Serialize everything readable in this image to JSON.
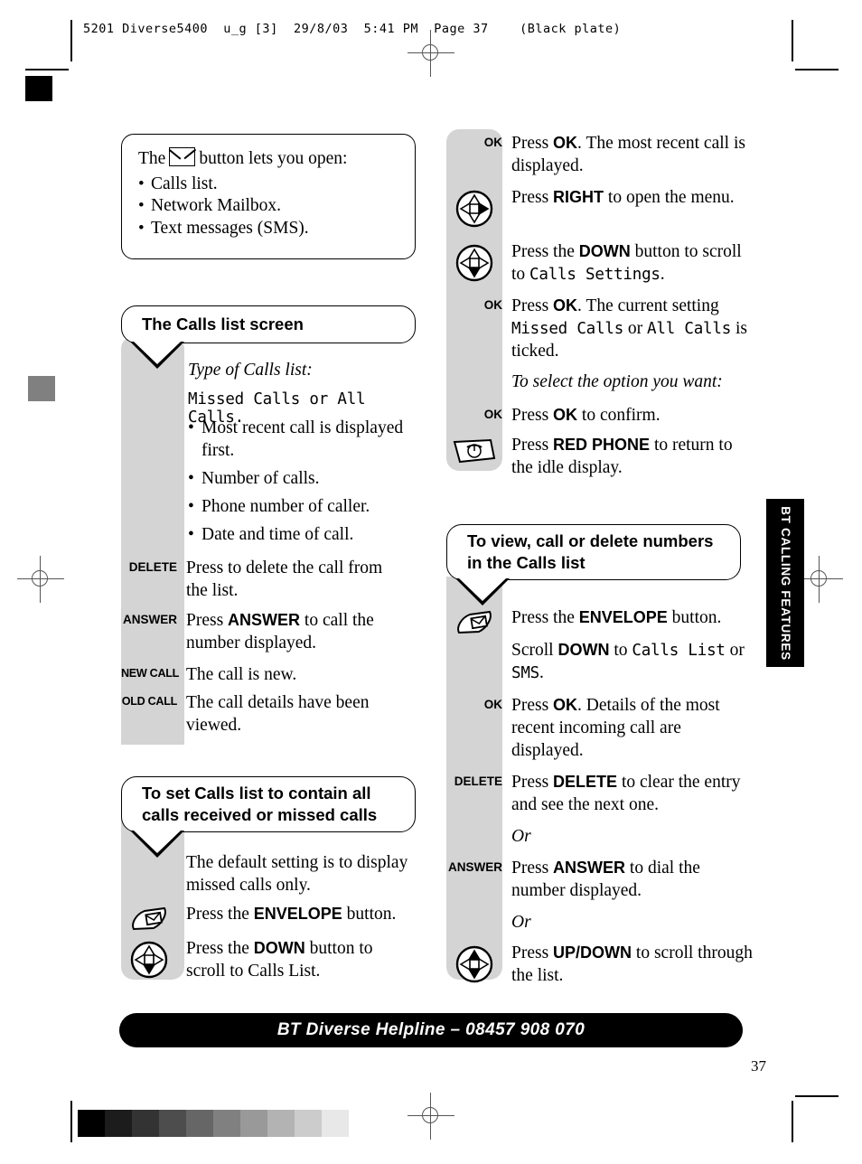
{
  "print_marks": {
    "slug": "5201 Diverse5400  u_g [3]  29/8/03  5:41 PM  Page 37    (Black plate)",
    "page_number": "37",
    "grayscale_swatches": [
      "#000000",
      "#1c1c1c",
      "#333333",
      "#4d4d4d",
      "#666666",
      "#808080",
      "#999999",
      "#b3b3b3",
      "#cccccc",
      "#e8e8e8"
    ],
    "corner_square_color": "#000000",
    "mid_square_color": "#808080"
  },
  "side_tab": {
    "label": "BT CALLING FEATURES"
  },
  "note_box": {
    "intro_before": "The",
    "icon": "envelope-icon",
    "intro_after": "button lets you open:",
    "items": [
      "Calls list.",
      "Network Mailbox.",
      "Text messages (SMS)."
    ]
  },
  "sections": [
    {
      "id": "calls-list-screen",
      "heading": "The Calls list screen",
      "rows": [
        {
          "key": "",
          "icon": "",
          "lines": [
            {
              "type": "italic",
              "text": "Type of Calls list:"
            }
          ]
        },
        {
          "key": "",
          "icon": "",
          "lines": [
            {
              "type": "lcd",
              "text": "Missed Calls or All Calls."
            }
          ]
        },
        {
          "key": "",
          "icon": "",
          "lines": [
            {
              "type": "bullet",
              "text": "Most recent call is displayed first."
            }
          ]
        },
        {
          "key": "",
          "icon": "",
          "lines": [
            {
              "type": "bullet",
              "text": "Number of calls."
            }
          ]
        },
        {
          "key": "",
          "icon": "",
          "lines": [
            {
              "type": "bullet",
              "text": "Phone number of caller."
            }
          ]
        },
        {
          "key": "",
          "icon": "",
          "lines": [
            {
              "type": "bullet",
              "text": "Date and time of call."
            }
          ]
        },
        {
          "key": "DELETE",
          "icon": "",
          "lines": [
            {
              "type": "text",
              "text": "Press to delete the call from the list."
            }
          ]
        },
        {
          "key": "ANSWER",
          "icon": "",
          "lines": [
            {
              "type": "rich",
              "parts": [
                {
                  "t": "Press "
                },
                {
                  "b": "ANSWER"
                },
                {
                  "t": " to call the number displayed."
                }
              ]
            }
          ]
        },
        {
          "key": "NEW CALL",
          "icon": "",
          "lines": [
            {
              "type": "text",
              "text": "The call is new."
            }
          ]
        },
        {
          "key": "OLD CALL",
          "icon": "",
          "lines": [
            {
              "type": "text",
              "text": "The call details have been viewed."
            }
          ]
        }
      ]
    },
    {
      "id": "set-calls-list",
      "heading": "To set Calls list to contain all calls received or missed calls",
      "rows": [
        {
          "key": "",
          "icon": "",
          "lines": [
            {
              "type": "text",
              "text": "The default setting is to display missed calls only."
            }
          ]
        },
        {
          "key": "",
          "icon": "envelope-key-icon",
          "lines": [
            {
              "type": "rich",
              "parts": [
                {
                  "t": "Press the "
                },
                {
                  "b": "ENVELOPE"
                },
                {
                  "t": " button."
                }
              ]
            }
          ]
        },
        {
          "key": "",
          "icon": "nav-down-icon",
          "lines": [
            {
              "type": "rich",
              "parts": [
                {
                  "t": "Press the "
                },
                {
                  "b": "DOWN"
                },
                {
                  "t": " button to scroll to Calls List."
                }
              ]
            }
          ]
        }
      ]
    },
    {
      "id": "right-top-steps",
      "heading": "",
      "rows": [
        {
          "key": "OK",
          "icon": "",
          "lines": [
            {
              "type": "rich",
              "parts": [
                {
                  "t": "Press "
                },
                {
                  "b": "OK"
                },
                {
                  "t": ". The most recent call is displayed."
                }
              ]
            }
          ]
        },
        {
          "key": "",
          "icon": "nav-right-icon",
          "lines": [
            {
              "type": "rich",
              "parts": [
                {
                  "t": "Press "
                },
                {
                  "b": "RIGHT"
                },
                {
                  "t": " to open the menu."
                }
              ]
            }
          ]
        },
        {
          "key": "",
          "icon": "nav-down-icon",
          "lines": [
            {
              "type": "rich",
              "parts": [
                {
                  "t": "Press the "
                },
                {
                  "b": "DOWN"
                },
                {
                  "t": " button to scroll to "
                },
                {
                  "lcd": "Calls Settings"
                },
                {
                  "t": "."
                }
              ]
            }
          ]
        },
        {
          "key": "OK",
          "icon": "",
          "lines": [
            {
              "type": "rich",
              "parts": [
                {
                  "t": "Press "
                },
                {
                  "b": "OK"
                },
                {
                  "t": ". The current setting "
                },
                {
                  "lcd": "Missed Calls"
                },
                {
                  "t": " or "
                },
                {
                  "lcd": "All Calls"
                },
                {
                  "t": " is ticked."
                }
              ]
            }
          ]
        },
        {
          "key": "",
          "icon": "",
          "lines": [
            {
              "type": "italic",
              "text": "To select the option you want:"
            }
          ]
        },
        {
          "key": "OK",
          "icon": "",
          "lines": [
            {
              "type": "rich",
              "parts": [
                {
                  "t": "Press "
                },
                {
                  "b": "OK"
                },
                {
                  "t": " to confirm."
                }
              ]
            }
          ]
        },
        {
          "key": "",
          "icon": "red-phone-icon",
          "lines": [
            {
              "type": "rich",
              "parts": [
                {
                  "t": "Press "
                },
                {
                  "b": "RED PHONE"
                },
                {
                  "t": " to return to the idle display."
                }
              ]
            }
          ]
        }
      ]
    },
    {
      "id": "view-call-delete",
      "heading": "To view, call or delete numbers in the Calls list",
      "rows": [
        {
          "key": "",
          "icon": "envelope-key-icon",
          "lines": [
            {
              "type": "rich",
              "parts": [
                {
                  "t": "Press the "
                },
                {
                  "b": "ENVELOPE"
                },
                {
                  "t": " button."
                }
              ]
            }
          ]
        },
        {
          "key": "",
          "icon": "",
          "lines": [
            {
              "type": "rich",
              "parts": [
                {
                  "t": "Scroll "
                },
                {
                  "b": "DOWN"
                },
                {
                  "t": " to "
                },
                {
                  "lcd": "Calls List"
                },
                {
                  "t": " or "
                },
                {
                  "lcd": "SMS"
                },
                {
                  "t": "."
                }
              ]
            }
          ]
        },
        {
          "key": "OK",
          "icon": "",
          "lines": [
            {
              "type": "rich",
              "parts": [
                {
                  "t": "Press "
                },
                {
                  "b": "OK"
                },
                {
                  "t": ". Details of the most recent incoming call are displayed."
                }
              ]
            }
          ]
        },
        {
          "key": "DELETE",
          "icon": "",
          "lines": [
            {
              "type": "rich",
              "parts": [
                {
                  "t": "Press "
                },
                {
                  "b": "DELETE"
                },
                {
                  "t": " to clear the entry and see the next one."
                }
              ]
            }
          ]
        },
        {
          "key": "",
          "icon": "",
          "lines": [
            {
              "type": "italic",
              "text": "Or"
            }
          ]
        },
        {
          "key": "ANSWER",
          "icon": "",
          "lines": [
            {
              "type": "rich",
              "parts": [
                {
                  "t": "Press "
                },
                {
                  "b": "ANSWER"
                },
                {
                  "t": " to dial the number displayed."
                }
              ]
            }
          ]
        },
        {
          "key": "",
          "icon": "",
          "lines": [
            {
              "type": "italic",
              "text": "Or"
            }
          ]
        },
        {
          "key": "",
          "icon": "nav-updown-icon",
          "lines": [
            {
              "type": "rich",
              "parts": [
                {
                  "t": "Press "
                },
                {
                  "b": "UP/DOWN"
                },
                {
                  "t": " to scroll through the list."
                }
              ]
            }
          ]
        }
      ]
    }
  ],
  "footer": {
    "helpline": "BT Diverse Helpline – 08457 908 070"
  }
}
